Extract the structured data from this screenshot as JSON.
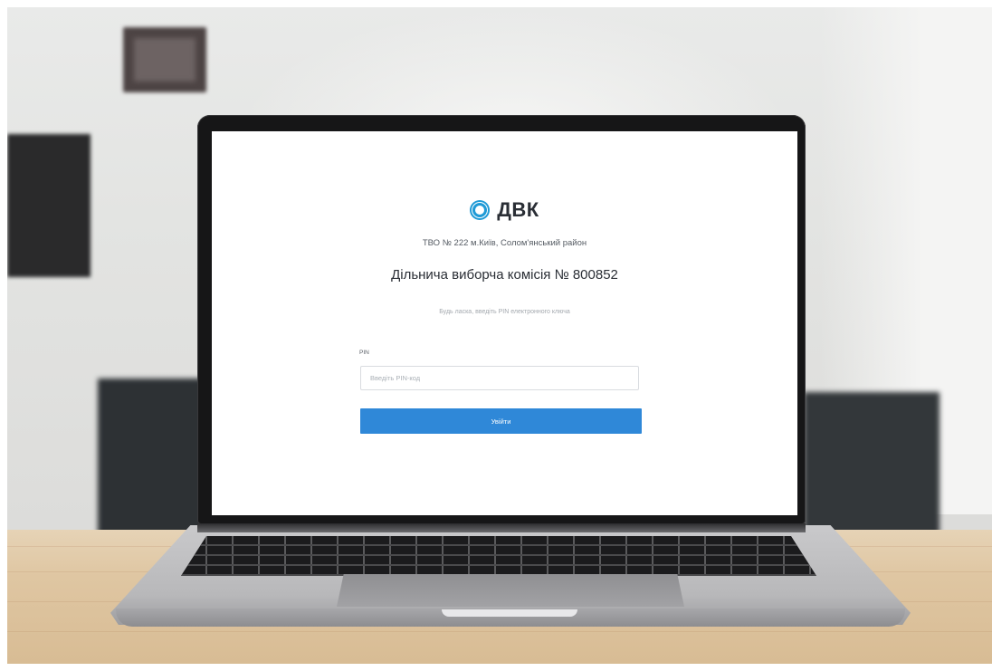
{
  "app": {
    "brand_name": "ДВК",
    "brand_icon": "target-logo-icon",
    "accent_color": "#2f88d8"
  },
  "login": {
    "station": "ТВО № 222 м.Київ, Солом'янський район",
    "heading": "Дільнича виборча комісія № 800852",
    "hint": "Будь ласка, введіть PIN електронного ключа",
    "pin_label": "PIN",
    "pin_placeholder": "Введіть PIN-код",
    "pin_value": "",
    "submit_label": "Увійти"
  }
}
